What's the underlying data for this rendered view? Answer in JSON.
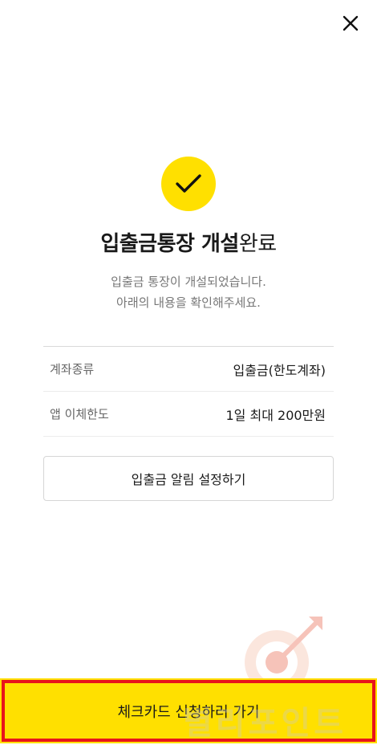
{
  "header": {
    "close_icon": "close-icon"
  },
  "status": {
    "icon": "checkmark-icon",
    "accent_color": "#ffe000"
  },
  "title": {
    "bold": "입출금통장 개설",
    "normal": "완료"
  },
  "subtitle": {
    "line1": "입출금 통장이 개설되었습니다.",
    "line2": "아래의 내용을 확인해주세요."
  },
  "info": {
    "rows": [
      {
        "label": "계좌종류",
        "value": "입출금(한도계좌)"
      },
      {
        "label": "앱 이체한도",
        "value": "1일 최대 200만원"
      }
    ]
  },
  "actions": {
    "notification_label": "입출금 알림 설정하기",
    "primary_label": "체크카드 신청하러 가기"
  },
  "annotation": {
    "highlight_color": "#e8141b"
  },
  "watermark": {
    "text": "별리포인트",
    "icon": "target-arrow-logo"
  }
}
